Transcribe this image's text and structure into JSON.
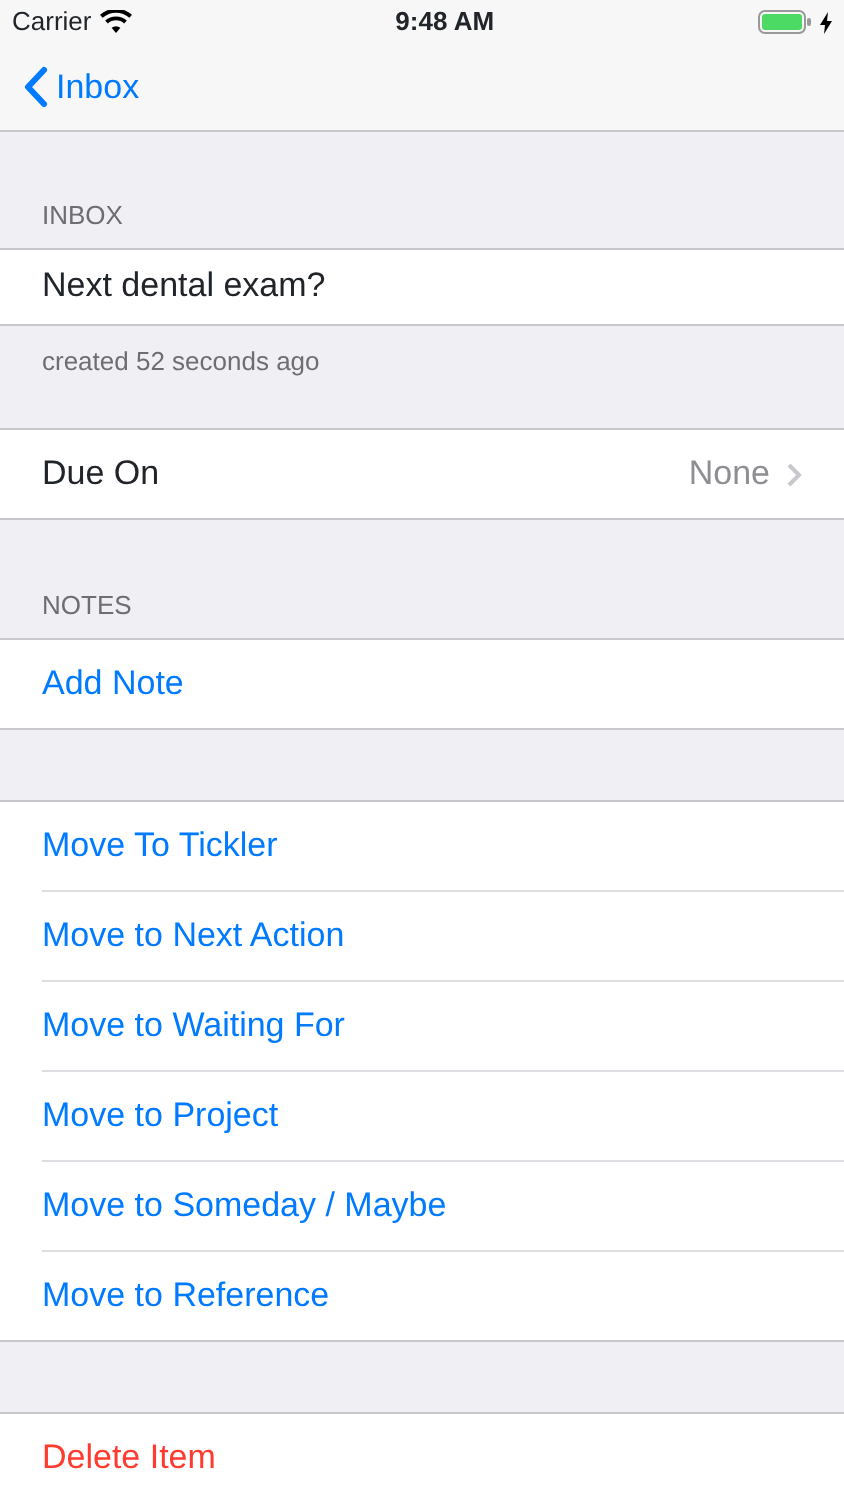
{
  "status_bar": {
    "carrier": "Carrier",
    "time": "9:48 AM",
    "charging": true
  },
  "nav": {
    "back": "Inbox"
  },
  "item": {
    "header": "INBOX",
    "title": "Next dental exam?",
    "footer": "created 52 seconds ago"
  },
  "due": {
    "label": "Due On",
    "value": "None"
  },
  "notes": {
    "header": "NOTES",
    "action": "Add Note"
  },
  "moves": [
    {
      "label": "Move To Tickler",
      "kind": "action"
    },
    {
      "label": "Move to Next Action",
      "kind": "action"
    },
    {
      "label": "Move to Waiting For",
      "kind": "action"
    },
    {
      "label": "Move to Project",
      "kind": "action"
    },
    {
      "label": "Move to Someday / Maybe",
      "kind": "action"
    },
    {
      "label": "Move to Reference",
      "kind": "action"
    }
  ],
  "danger": [
    {
      "label": "Delete Item",
      "kind": "destructive"
    }
  ]
}
